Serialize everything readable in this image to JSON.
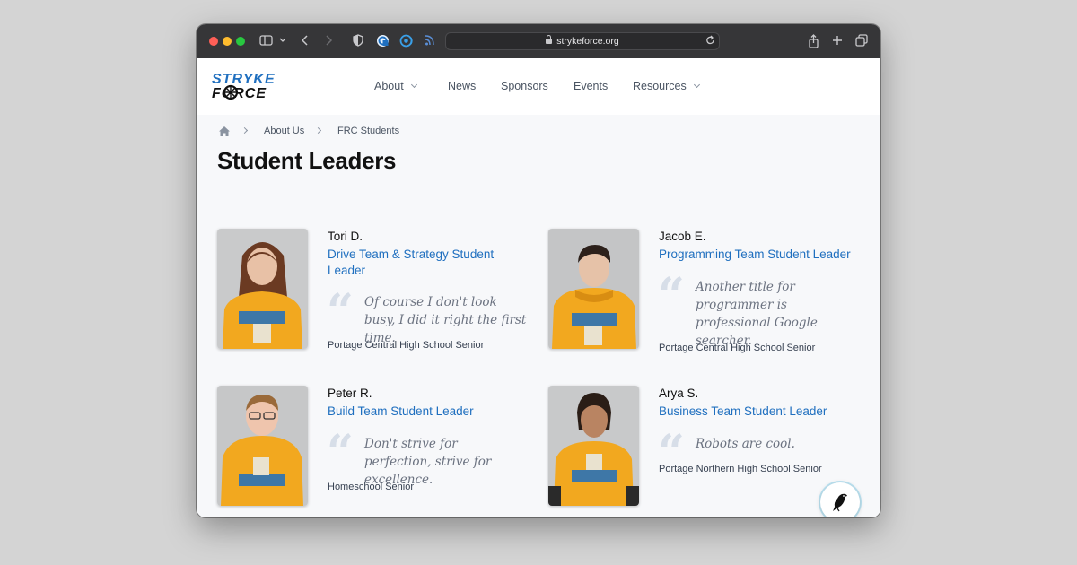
{
  "browser": {
    "url": "strykeforce.org",
    "icons": [
      "sidebar-icon",
      "chevron-down-icon",
      "back-icon",
      "forward-icon",
      "shield-icon",
      "extension-icon",
      "extension-icon-2",
      "rss-icon",
      "reload-icon",
      "share-icon",
      "new-tab-icon",
      "tabs-icon"
    ]
  },
  "site": {
    "logo_text": [
      "STRYKE",
      "FORCE"
    ],
    "nav": [
      {
        "label": "About",
        "has_dropdown": true
      },
      {
        "label": "News",
        "has_dropdown": false
      },
      {
        "label": "Sponsors",
        "has_dropdown": false
      },
      {
        "label": "Events",
        "has_dropdown": false
      },
      {
        "label": "Resources",
        "has_dropdown": true
      }
    ]
  },
  "breadcrumb": [
    "About Us",
    "FRC Students"
  ],
  "page": {
    "title": "Student Leaders"
  },
  "leaders": [
    {
      "name": "Tori D.",
      "role": "Drive Team & Strategy Student Leader",
      "quote": "Of course I don't look busy, I did it right the first time.",
      "school": "Portage Central High School Senior"
    },
    {
      "name": "Jacob E.",
      "role": "Programming Team Student Leader",
      "quote": "Another title for programmer is professional Google searcher.",
      "school": "Portage Central High School Senior"
    },
    {
      "name": "Peter R.",
      "role": "Build Team Student Leader",
      "quote": "Don't strive for perfection, strive for excellence.",
      "school": "Homeschool Senior"
    },
    {
      "name": "Arya S.",
      "role": "Business Team Student Leader",
      "quote": "Robots are cool.",
      "school": "Portage Northern High School Senior"
    }
  ],
  "colors": {
    "accent": "#1f6fbf",
    "shirt": "#f2a81f",
    "titlebar": "#363638"
  }
}
